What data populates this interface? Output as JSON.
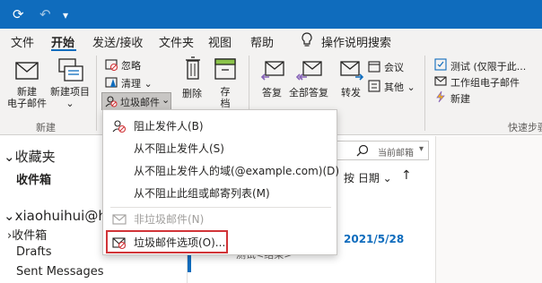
{
  "colors": {
    "accent": "#0f6cbd",
    "ribbon_bg": "#f3f2f1",
    "highlight": "#d13438",
    "date_blue": "#0f6cbd"
  },
  "titlebar": {
    "icons": [
      "sync-icon",
      "undo-icon",
      "quick-access-dropdown-icon"
    ],
    "sync_glyph": "⟳",
    "undo_glyph": "↶",
    "dropdown_glyph": "▾"
  },
  "tabs": {
    "file": "文件",
    "home": "开始",
    "send_receive": "发送/接收",
    "folder": "文件夹",
    "view": "视图",
    "help": "帮助",
    "tell_me": "操作说明搜索",
    "lightbulb_glyph": "💡"
  },
  "ribbon": {
    "new_email": "新建\n电子邮件",
    "new_email_l1": "新建",
    "new_email_l2": "电子邮件",
    "new_item": "新建项目",
    "new_item_caret": "⌄",
    "group_new": "新建",
    "ignore": "忽略",
    "clean": "清理",
    "clean_caret": "⌄",
    "junk": "垃圾邮件",
    "junk_caret": "⌄",
    "delete": "删除",
    "archive_l1": "存",
    "archive_l2": "档",
    "reply": "答复",
    "reply_all": "全部答复",
    "forward": "转发",
    "meeting": "会议",
    "other": "其他",
    "other_caret": "⌄",
    "qs_test": "测试 (仅限于此...",
    "qs_team_email": "工作组电子邮件",
    "qs_new": "新建",
    "group_quicksteps": "快速步骤"
  },
  "nav": {
    "favorites": "收藏夹",
    "inbox_fav": "收件箱",
    "account": "xiaohuihui@hu",
    "inbox": "收件箱",
    "drafts": "Drafts",
    "sent": "Sent Messages",
    "chevron_down": "⌄",
    "chevron_right": "›"
  },
  "list": {
    "search_scope": "当前邮箱",
    "search_caret": "▾",
    "sort_label": "按 日期",
    "sort_caret": "⌄",
    "sort_arrow": "↑",
    "date": "2021/5/28",
    "sender_partial": "测试<结果>"
  },
  "menu": {
    "items": [
      {
        "label": "阻止发件人(B)",
        "disabled": false
      },
      {
        "label": "从不阻止发件人(S)",
        "disabled": false
      },
      {
        "label": "从不阻止发件人的域(@example.com)(D)",
        "disabled": false
      },
      {
        "label": "从不阻止此组或邮寄列表(M)",
        "disabled": false
      },
      {
        "label": "非垃圾邮件(N)",
        "disabled": true
      },
      {
        "label": "垃圾邮件选项(O)...",
        "disabled": false
      }
    ]
  }
}
